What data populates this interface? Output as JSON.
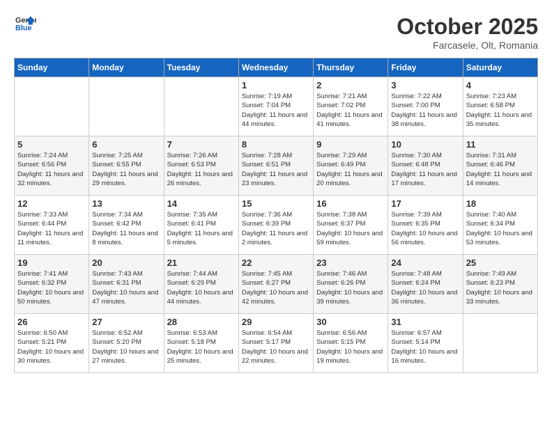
{
  "header": {
    "logo_line1": "General",
    "logo_line2": "Blue",
    "month": "October 2025",
    "location": "Farcasele, Olt, Romania"
  },
  "weekdays": [
    "Sunday",
    "Monday",
    "Tuesday",
    "Wednesday",
    "Thursday",
    "Friday",
    "Saturday"
  ],
  "weeks": [
    [
      {
        "day": "",
        "sunrise": "",
        "sunset": "",
        "daylight": ""
      },
      {
        "day": "",
        "sunrise": "",
        "sunset": "",
        "daylight": ""
      },
      {
        "day": "",
        "sunrise": "",
        "sunset": "",
        "daylight": ""
      },
      {
        "day": "1",
        "sunrise": "Sunrise: 7:19 AM",
        "sunset": "Sunset: 7:04 PM",
        "daylight": "Daylight: 11 hours and 44 minutes."
      },
      {
        "day": "2",
        "sunrise": "Sunrise: 7:21 AM",
        "sunset": "Sunset: 7:02 PM",
        "daylight": "Daylight: 11 hours and 41 minutes."
      },
      {
        "day": "3",
        "sunrise": "Sunrise: 7:22 AM",
        "sunset": "Sunset: 7:00 PM",
        "daylight": "Daylight: 11 hours and 38 minutes."
      },
      {
        "day": "4",
        "sunrise": "Sunrise: 7:23 AM",
        "sunset": "Sunset: 6:58 PM",
        "daylight": "Daylight: 11 hours and 35 minutes."
      }
    ],
    [
      {
        "day": "5",
        "sunrise": "Sunrise: 7:24 AM",
        "sunset": "Sunset: 6:56 PM",
        "daylight": "Daylight: 11 hours and 32 minutes."
      },
      {
        "day": "6",
        "sunrise": "Sunrise: 7:25 AM",
        "sunset": "Sunset: 6:55 PM",
        "daylight": "Daylight: 11 hours and 29 minutes."
      },
      {
        "day": "7",
        "sunrise": "Sunrise: 7:26 AM",
        "sunset": "Sunset: 6:53 PM",
        "daylight": "Daylight: 11 hours and 26 minutes."
      },
      {
        "day": "8",
        "sunrise": "Sunrise: 7:28 AM",
        "sunset": "Sunset: 6:51 PM",
        "daylight": "Daylight: 11 hours and 23 minutes."
      },
      {
        "day": "9",
        "sunrise": "Sunrise: 7:29 AM",
        "sunset": "Sunset: 6:49 PM",
        "daylight": "Daylight: 11 hours and 20 minutes."
      },
      {
        "day": "10",
        "sunrise": "Sunrise: 7:30 AM",
        "sunset": "Sunset: 6:48 PM",
        "daylight": "Daylight: 11 hours and 17 minutes."
      },
      {
        "day": "11",
        "sunrise": "Sunrise: 7:31 AM",
        "sunset": "Sunset: 6:46 PM",
        "daylight": "Daylight: 11 hours and 14 minutes."
      }
    ],
    [
      {
        "day": "12",
        "sunrise": "Sunrise: 7:33 AM",
        "sunset": "Sunset: 6:44 PM",
        "daylight": "Daylight: 11 hours and 11 minutes."
      },
      {
        "day": "13",
        "sunrise": "Sunrise: 7:34 AM",
        "sunset": "Sunset: 6:42 PM",
        "daylight": "Daylight: 11 hours and 8 minutes."
      },
      {
        "day": "14",
        "sunrise": "Sunrise: 7:35 AM",
        "sunset": "Sunset: 6:41 PM",
        "daylight": "Daylight: 11 hours and 5 minutes."
      },
      {
        "day": "15",
        "sunrise": "Sunrise: 7:36 AM",
        "sunset": "Sunset: 6:39 PM",
        "daylight": "Daylight: 11 hours and 2 minutes."
      },
      {
        "day": "16",
        "sunrise": "Sunrise: 7:38 AM",
        "sunset": "Sunset: 6:37 PM",
        "daylight": "Daylight: 10 hours and 59 minutes."
      },
      {
        "day": "17",
        "sunrise": "Sunrise: 7:39 AM",
        "sunset": "Sunset: 6:35 PM",
        "daylight": "Daylight: 10 hours and 56 minutes."
      },
      {
        "day": "18",
        "sunrise": "Sunrise: 7:40 AM",
        "sunset": "Sunset: 6:34 PM",
        "daylight": "Daylight: 10 hours and 53 minutes."
      }
    ],
    [
      {
        "day": "19",
        "sunrise": "Sunrise: 7:41 AM",
        "sunset": "Sunset: 6:32 PM",
        "daylight": "Daylight: 10 hours and 50 minutes."
      },
      {
        "day": "20",
        "sunrise": "Sunrise: 7:43 AM",
        "sunset": "Sunset: 6:31 PM",
        "daylight": "Daylight: 10 hours and 47 minutes."
      },
      {
        "day": "21",
        "sunrise": "Sunrise: 7:44 AM",
        "sunset": "Sunset: 6:29 PM",
        "daylight": "Daylight: 10 hours and 44 minutes."
      },
      {
        "day": "22",
        "sunrise": "Sunrise: 7:45 AM",
        "sunset": "Sunset: 6:27 PM",
        "daylight": "Daylight: 10 hours and 42 minutes."
      },
      {
        "day": "23",
        "sunrise": "Sunrise: 7:46 AM",
        "sunset": "Sunset: 6:26 PM",
        "daylight": "Daylight: 10 hours and 39 minutes."
      },
      {
        "day": "24",
        "sunrise": "Sunrise: 7:48 AM",
        "sunset": "Sunset: 6:24 PM",
        "daylight": "Daylight: 10 hours and 36 minutes."
      },
      {
        "day": "25",
        "sunrise": "Sunrise: 7:49 AM",
        "sunset": "Sunset: 6:23 PM",
        "daylight": "Daylight: 10 hours and 33 minutes."
      }
    ],
    [
      {
        "day": "26",
        "sunrise": "Sunrise: 6:50 AM",
        "sunset": "Sunset: 5:21 PM",
        "daylight": "Daylight: 10 hours and 30 minutes."
      },
      {
        "day": "27",
        "sunrise": "Sunrise: 6:52 AM",
        "sunset": "Sunset: 5:20 PM",
        "daylight": "Daylight: 10 hours and 27 minutes."
      },
      {
        "day": "28",
        "sunrise": "Sunrise: 6:53 AM",
        "sunset": "Sunset: 5:18 PM",
        "daylight": "Daylight: 10 hours and 25 minutes."
      },
      {
        "day": "29",
        "sunrise": "Sunrise: 6:54 AM",
        "sunset": "Sunset: 5:17 PM",
        "daylight": "Daylight: 10 hours and 22 minutes."
      },
      {
        "day": "30",
        "sunrise": "Sunrise: 6:56 AM",
        "sunset": "Sunset: 5:15 PM",
        "daylight": "Daylight: 10 hours and 19 minutes."
      },
      {
        "day": "31",
        "sunrise": "Sunrise: 6:57 AM",
        "sunset": "Sunset: 5:14 PM",
        "daylight": "Daylight: 10 hours and 16 minutes."
      },
      {
        "day": "",
        "sunrise": "",
        "sunset": "",
        "daylight": ""
      }
    ]
  ]
}
